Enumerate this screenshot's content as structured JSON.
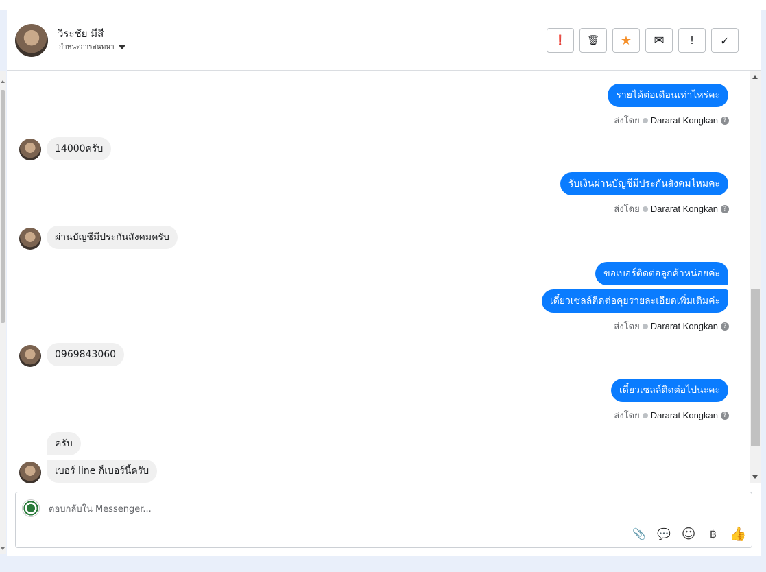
{
  "contact": {
    "name": "วีระชัย มีสี",
    "assign_label": "กำหนดการสนทนา"
  },
  "actions": [
    {
      "name": "mark-spam-button",
      "icon": "alert-circle-icon",
      "glyph": "❗"
    },
    {
      "name": "delete-button",
      "icon": "trash-icon",
      "glyph": "🗑"
    },
    {
      "name": "star-button",
      "icon": "star-icon",
      "glyph": "★"
    },
    {
      "name": "mark-unread-button",
      "icon": "envelope-icon",
      "glyph": "✉"
    },
    {
      "name": "follow-up-button",
      "icon": "exclamation-icon",
      "glyph": "!"
    },
    {
      "name": "mark-done-button",
      "icon": "check-icon",
      "glyph": "✓"
    }
  ],
  "messages": [
    {
      "dir": "out",
      "text": "รายได้ต่อเดือนเท่าไหร่คะ"
    },
    {
      "dir": "in",
      "text": "14000ครับ"
    },
    {
      "dir": "out",
      "text": "รับเงินผ่านบัญชีมีประกันสังคมไหมคะ"
    },
    {
      "dir": "in",
      "text": "ผ่านบัญชีมีประกันสังคมครับ"
    },
    {
      "dir": "out",
      "text": "ขอเบอร์ติดต่อลูกค้าหน่อยค่ะ"
    },
    {
      "dir": "out",
      "text": "เดี๋ยวเซลล์ติดต่อคุยรายละเอียดเพิ่มเติมค่ะ"
    },
    {
      "dir": "in",
      "text": "0969843060"
    },
    {
      "dir": "out",
      "text": "เดี๋ยวเซลล์ติดต่อไปนะคะ"
    },
    {
      "dir": "in",
      "text": "ครับ"
    },
    {
      "dir": "in",
      "text": "เบอร์ line ก็เบอร์นี้ครับ"
    }
  ],
  "sent_by": {
    "prefix": "ส่งโดย",
    "agent": "Dararat Kongkan",
    "help": "?"
  },
  "composer": {
    "placeholder": "ตอบกลับใน Messenger...",
    "tools": [
      {
        "name": "attach-icon",
        "glyph": "📎"
      },
      {
        "name": "saved-reply-icon",
        "glyph": "💬"
      },
      {
        "name": "emoji-icon",
        "glyph": "☺"
      },
      {
        "name": "payment-icon",
        "glyph": "฿"
      },
      {
        "name": "like-icon",
        "glyph": "👍"
      }
    ]
  }
}
